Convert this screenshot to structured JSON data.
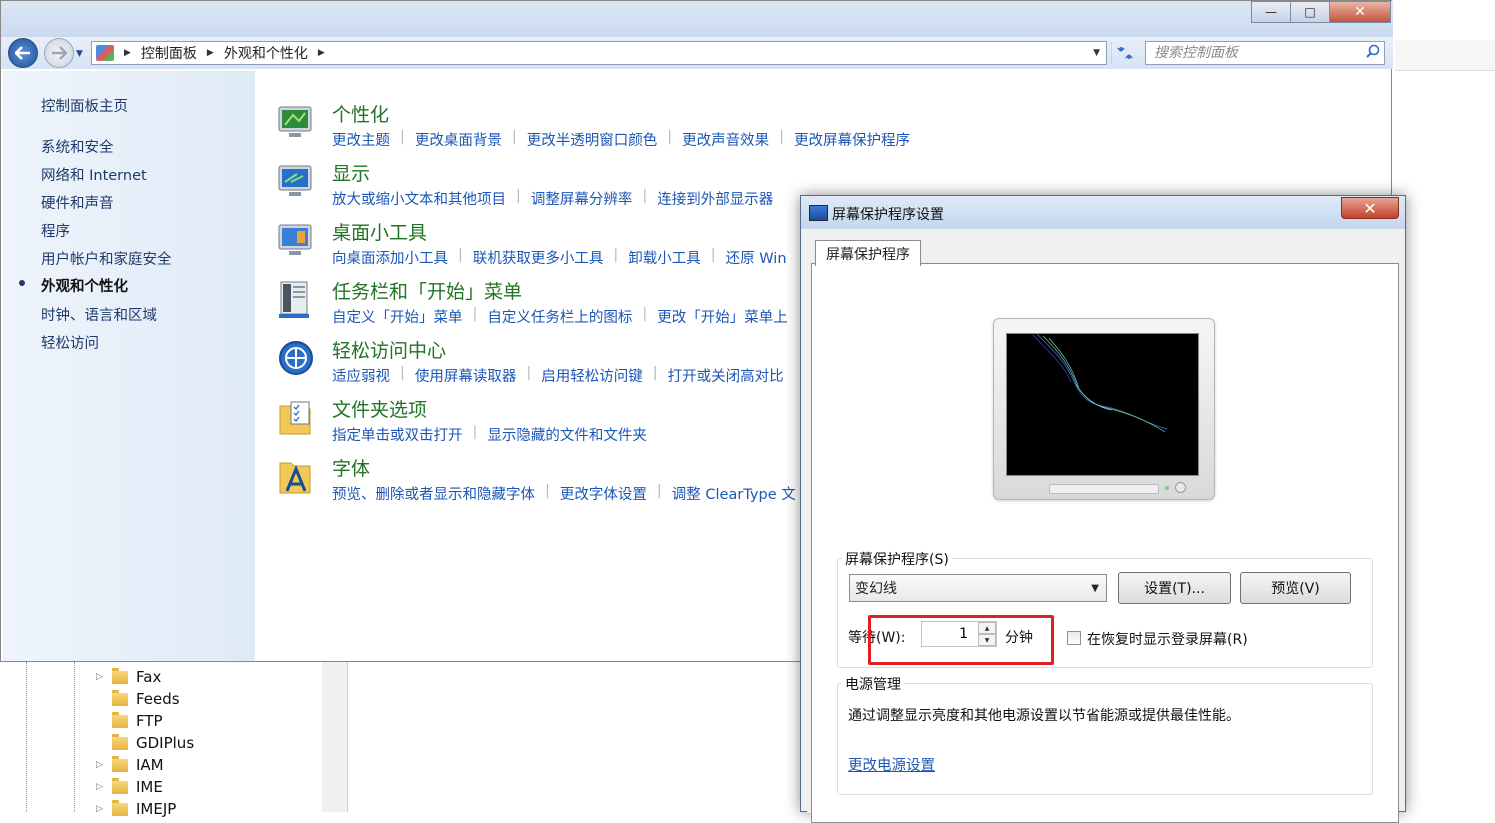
{
  "window": {
    "title": "",
    "controls": [
      "—",
      "□",
      "✕"
    ]
  },
  "nav": {
    "breadcrumb": [
      "控制面板",
      "外观和个性化"
    ],
    "search_placeholder": "搜索控制面板"
  },
  "sidebar": {
    "items": [
      {
        "label": "控制面板主页"
      },
      {
        "label": "系统和安全"
      },
      {
        "label": "网络和 Internet"
      },
      {
        "label": "硬件和声音"
      },
      {
        "label": "程序"
      },
      {
        "label": "用户帐户和家庭安全"
      },
      {
        "label": "外观和个性化",
        "current": true
      },
      {
        "label": "时钟、语言和区域"
      },
      {
        "label": "轻松访问"
      }
    ]
  },
  "categories": [
    {
      "title": "个性化",
      "icon": "personalization-icon",
      "links": [
        "更改主题",
        "更改桌面背景",
        "更改半透明窗口颜色",
        "更改声音效果",
        "更改屏幕保护程序"
      ]
    },
    {
      "title": "显示",
      "icon": "display-icon",
      "links": [
        "放大或缩小文本和其他项目",
        "调整屏幕分辨率",
        "连接到外部显示器"
      ]
    },
    {
      "title": "桌面小工具",
      "icon": "gadgets-icon",
      "links": [
        "向桌面添加小工具",
        "联机获取更多小工具",
        "卸载小工具",
        "还原 Win"
      ]
    },
    {
      "title": "任务栏和「开始」菜单",
      "icon": "taskbar-icon",
      "links": [
        "自定义「开始」菜单",
        "自定义任务栏上的图标",
        "更改「开始」菜单上"
      ]
    },
    {
      "title": "轻松访问中心",
      "icon": "ease-of-access-icon",
      "links": [
        "适应弱视",
        "使用屏幕读取器",
        "启用轻松访问键",
        "打开或关闭高对比"
      ]
    },
    {
      "title": "文件夹选项",
      "icon": "folder-options-icon",
      "links": [
        "指定单击或双击打开",
        "显示隐藏的文件和文件夹"
      ]
    },
    {
      "title": "字体",
      "icon": "fonts-icon",
      "links": [
        "预览、删除或者显示和隐藏字体",
        "更改字体设置",
        "调整 ClearType 文"
      ]
    }
  ],
  "background_tree": {
    "items": [
      "Fax",
      "Feeds",
      "FTP",
      "GDIPlus",
      "IAM",
      "IME",
      "IMEJP"
    ]
  },
  "dialog": {
    "title": "屏幕保护程序设置",
    "close": "✕",
    "tab": "屏幕保护程序",
    "screensaver_group": "屏幕保护程序(S)",
    "selected_screensaver": "变幻线",
    "settings_button": "设置(T)...",
    "preview_button": "预览(V)",
    "wait_label": "等待(W):",
    "wait_value": "1",
    "minutes_label": "分钟",
    "resume_label": "在恢复时显示登录屏幕(R)",
    "resume_checked": false,
    "power_group": "电源管理",
    "power_desc": "通过调整显示亮度和其他电源设置以节省能源或提供最佳性能。",
    "power_link": "更改电源设置"
  },
  "colors": {
    "category_title": "#237326",
    "link": "#1c57b5",
    "highlight": "#e02020"
  }
}
